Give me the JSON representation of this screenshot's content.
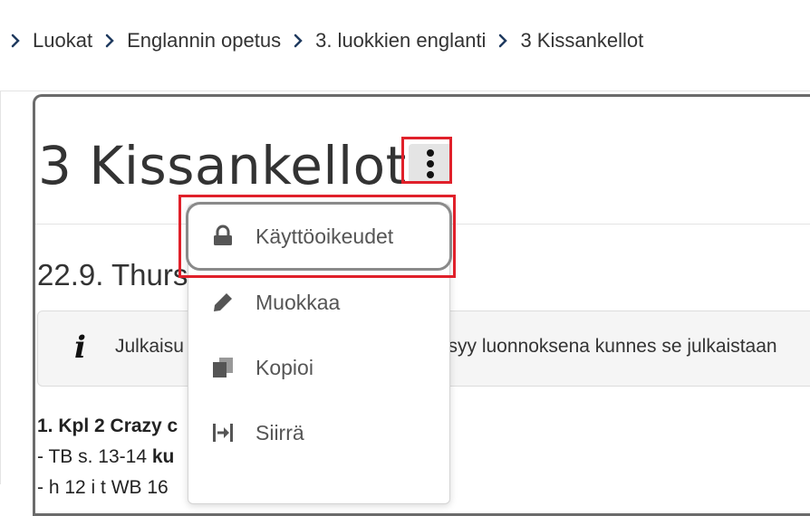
{
  "breadcrumb": {
    "items": [
      {
        "label": "Luokat"
      },
      {
        "label": "Englannin opetus"
      },
      {
        "label": "3. luokkien englanti"
      },
      {
        "label": "3 Kissankellot"
      }
    ]
  },
  "page": {
    "title": "3 Kissankellot",
    "section_title": "22.9. Thurs",
    "alert": {
      "icon": "info-icon",
      "text_left": "Julkaisu",
      "text_right": "ysyy luonnoksena kunnes se julkaistaan"
    },
    "body_line_1_a": "1. Kpl 2 Crazy c",
    "body_line_2_a": "- TB s. 13-14 ",
    "body_line_2_b": "ku",
    "body_line_3": "-  h     12      i                                               t    WB   16"
  },
  "actions_menu": {
    "trigger_icon": "more-vertical-icon",
    "items": [
      {
        "label": "Käyttöoikeudet",
        "icon": "lock-icon"
      },
      {
        "label": "Muokkaa",
        "icon": "pencil-icon"
      },
      {
        "label": "Kopioi",
        "icon": "copy-icon"
      },
      {
        "label": "Siirrä",
        "icon": "move-icon"
      }
    ]
  },
  "colors": {
    "highlight": "#e0202a",
    "text": "#333333",
    "menu_text": "#555555",
    "icon": "#555555",
    "alert_bg": "#f5f5f5"
  }
}
